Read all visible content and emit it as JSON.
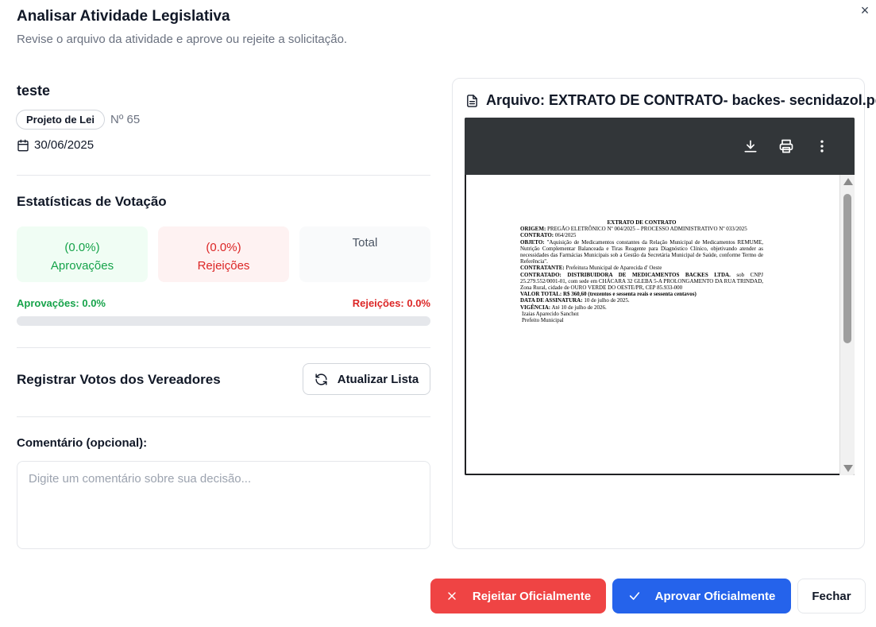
{
  "dialog": {
    "title": "Analisar Atividade Legislativa",
    "subtitle": "Revise o arquivo da atividade e aprove ou rejeite a solicitação.",
    "close_icon": "×"
  },
  "activity": {
    "name": "teste",
    "type_badge": "Projeto de Lei",
    "number": "Nº 65",
    "date": "30/06/2025"
  },
  "voting_stats": {
    "title": "Estatísticas de Votação",
    "approvals": {
      "pct": "(0.0%)",
      "label": "Aprovações"
    },
    "rejections": {
      "pct": "(0.0%)",
      "label": "Rejeições"
    },
    "total": {
      "label": "Total"
    },
    "approvals_legend": "Aprovações: 0.0%",
    "rejections_legend": "Rejeições: 0.0%",
    "approval_progress": 0
  },
  "votes": {
    "title": "Registrar Votos dos Vereadores",
    "refresh_label": "Atualizar Lista"
  },
  "comment": {
    "label": "Comentário (opcional):",
    "placeholder": "Digite um comentário sobre sua decisão...",
    "value": ""
  },
  "file": {
    "title": "Arquivo: EXTRATO DE CONTRATO- backes- secnidazol.pdf",
    "doc": {
      "heading": "EXTRATO DE CONTRATO",
      "origem_label": "ORIGEM:",
      "origem": " PREGÃO ELETRÔNICO Nº 004/2025 – PROCESSO ADMINISTRATIVO Nº 033/2025",
      "contrato_label": "CONTRATO:",
      "contrato": " 064/2025",
      "objeto_label": "OBJETO:",
      "objeto": " \"Aquisição de Medicamentos constantes da Relação Municipal de Medicamentos REMUME, Nutrição Complementar Balanceada e Tiras Reagente para Diagnóstico Clínico, objetivando atender as necessidades das Farmácias Municipais sob a Gestão da Secretária Municipal de Saúde, conforme Termo de Referência\".",
      "contratante_label": "CONTRATANTE:",
      "contratante": " Prefeitura Municipal de Aparecida d' Oeste",
      "contratado_label": "CONTRATADO: DISTRIBUIDORA DE MEDICAMENTOS BACKES LTDA.",
      "contratado": " sob CNPJ 25.279.552/0001-01, com sede em CHÁCARA 32 GLEBA 5-A PROLONGAMENTO DA RUA TRINDAD, Zona Rural, cidade de OURO VERDE DO OESTE/PR, CEP 85.933-000",
      "valor_label": "VALOR TOTAL: R$ 360,60 (trezentos e sessenta reais e sessenta centavos)",
      "assinatura_label": "DATA DE ASSINATURA:",
      "assinatura": " 10 de julho de 2025.",
      "vigencia_label": "VIGÊNCIA:",
      "vigencia": " Até 10 de julho de 2026.",
      "signer_name": "Izaias Aparecido Sanchez",
      "signer_role": "Prefeito Municipal"
    }
  },
  "actions": {
    "reject_label": "Rejeitar Oficialmente",
    "approve_label": "Aprovar Oficialmente",
    "close_label": "Fechar"
  },
  "colors": {
    "approve_green": "#16a34a",
    "reject_red": "#ef4444",
    "primary_blue": "#2563eb",
    "pdf_toolbar": "#323639"
  },
  "icons": [
    "close-icon",
    "calendar-icon",
    "refresh-icon",
    "file-icon",
    "download-icon",
    "print-icon",
    "more-vertical-icon",
    "x-icon",
    "check-icon"
  ]
}
